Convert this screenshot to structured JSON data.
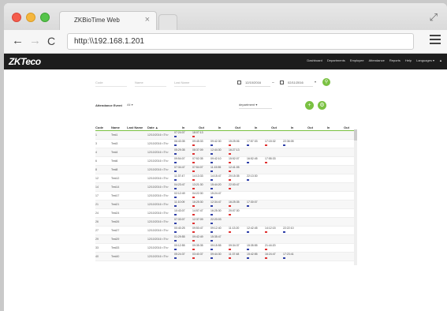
{
  "browser": {
    "tab_title": "ZKBioTime Web",
    "tab_close": "×",
    "url": "http:\\\\192.168.1.201",
    "expand_icon": "expand-icon",
    "back_glyph": "←",
    "forward_glyph": "→",
    "reload_glyph": "C"
  },
  "app": {
    "logo": "ZKTeco",
    "nav": [
      "Dashboard",
      "Departments",
      "Employee",
      "Attendance",
      "Reports",
      "Help",
      "Languages ▾",
      "▲"
    ]
  },
  "filters": {
    "code": "Code",
    "name": "Name",
    "last_name": "Last Name",
    "date_from": "12/10/2016",
    "date_to": "02/11/2016",
    "dash": "–",
    "event_label": "Attendance Event",
    "event_value": "All",
    "department": "department"
  },
  "table": {
    "headers": [
      "Code",
      "Name",
      "Last Name",
      "Date ▲",
      "In",
      "Out",
      "In",
      "Out",
      "In",
      "Out",
      "In",
      "Out",
      "In",
      "Out"
    ],
    "rows": [
      {
        "code": "1",
        "name": "Test1",
        "date": "12/10/2016 <Th>",
        "times": [
          "07:24:07",
          "18:07:13"
        ]
      },
      {
        "code": "3",
        "name": "Test3",
        "date": "12/10/2016 <Th>",
        "times": [
          "06:43:35",
          "09:45:33",
          "09:42:30",
          "15:25:06",
          "17:57:33",
          "17:15:32",
          "22:36:05"
        ]
      },
      {
        "code": "4",
        "name": "Test4",
        "date": "12/10/2016 <Th>",
        "times": [
          "05:29:35",
          "08:37:09",
          "12:44:30",
          "16:27:13"
        ]
      },
      {
        "code": "6",
        "name": "Test6",
        "date": "12/10/2016 <Th>",
        "times": [
          "09:54:07",
          "07:52:35",
          "09:42:10",
          "15:52:07",
          "16:52:45",
          "17:55:33"
        ]
      },
      {
        "code": "8",
        "name": "Test8",
        "date": "12/10/2016 <Th>",
        "times": [
          "07:34:47",
          "07:54:07",
          "11:15:55",
          "12:41:05"
        ]
      },
      {
        "code": "12",
        "name": "Test12",
        "date": "12/10/2016 <Th>",
        "times": [
          "11:37:47",
          "14:13:33",
          "14:15:47",
          "20:15:35",
          "22:13:30"
        ]
      },
      {
        "code": "14",
        "name": "Test14",
        "date": "12/10/2016 <Th>",
        "times": [
          "04:23:47",
          "13:21:30",
          "15:44:20",
          "22:00:47"
        ]
      },
      {
        "code": "17",
        "name": "Test17",
        "date": "12/10/2016 <Th>",
        "times": [
          "02:12:49",
          "04:22:30",
          "15:24:47"
        ]
      },
      {
        "code": "21",
        "name": "Test21",
        "date": "12/10/2016 <Th>",
        "times": [
          "11:10:09",
          "16:25:30",
          "12:34:47",
          "16:25:35",
          "17:30:07"
        ]
      },
      {
        "code": "24",
        "name": "Test24",
        "date": "12/10/2016 <Th>",
        "times": [
          "10:43:07",
          "14:57:47",
          "16:25:30",
          "20:07:30"
        ]
      },
      {
        "code": "26",
        "name": "Test26",
        "date": "12/10/2016 <Th>",
        "times": [
          "07:33:07",
          "12:37:09",
          "22:20:03"
        ]
      },
      {
        "code": "27",
        "name": "Test27",
        "date": "12/10/2016 <Th>",
        "times": [
          "00:40:25",
          "09:50:47",
          "09:12:40",
          "11:13:20",
          "12:42:45",
          "14:12:15",
          "22:22:10"
        ]
      },
      {
        "code": "29",
        "name": "Test29",
        "date": "12/10/2016 <Th>",
        "times": [
          "01:29:55",
          "09:42:49",
          "15:35:47"
        ]
      },
      {
        "code": "33",
        "name": "Test33",
        "date": "12/10/2016 <Th>",
        "times": [
          "00:12:55",
          "09:35:35",
          "09:15:55",
          "09:34:37",
          "15:35:55",
          "21:44:20"
        ]
      },
      {
        "code": "40",
        "name": "Test40",
        "date": "12/10/2016 <Th>",
        "times": [
          "05:24:37",
          "03:40:37",
          "09:44:30",
          "11:37:48",
          "15:42:55",
          "16:24:47",
          "17:23:41"
        ]
      }
    ]
  },
  "colors": {
    "accent_green": "#7ac142",
    "mark_blue": "#2f3fa8",
    "mark_red": "#e03131",
    "appbar": "#1d1d1d"
  }
}
